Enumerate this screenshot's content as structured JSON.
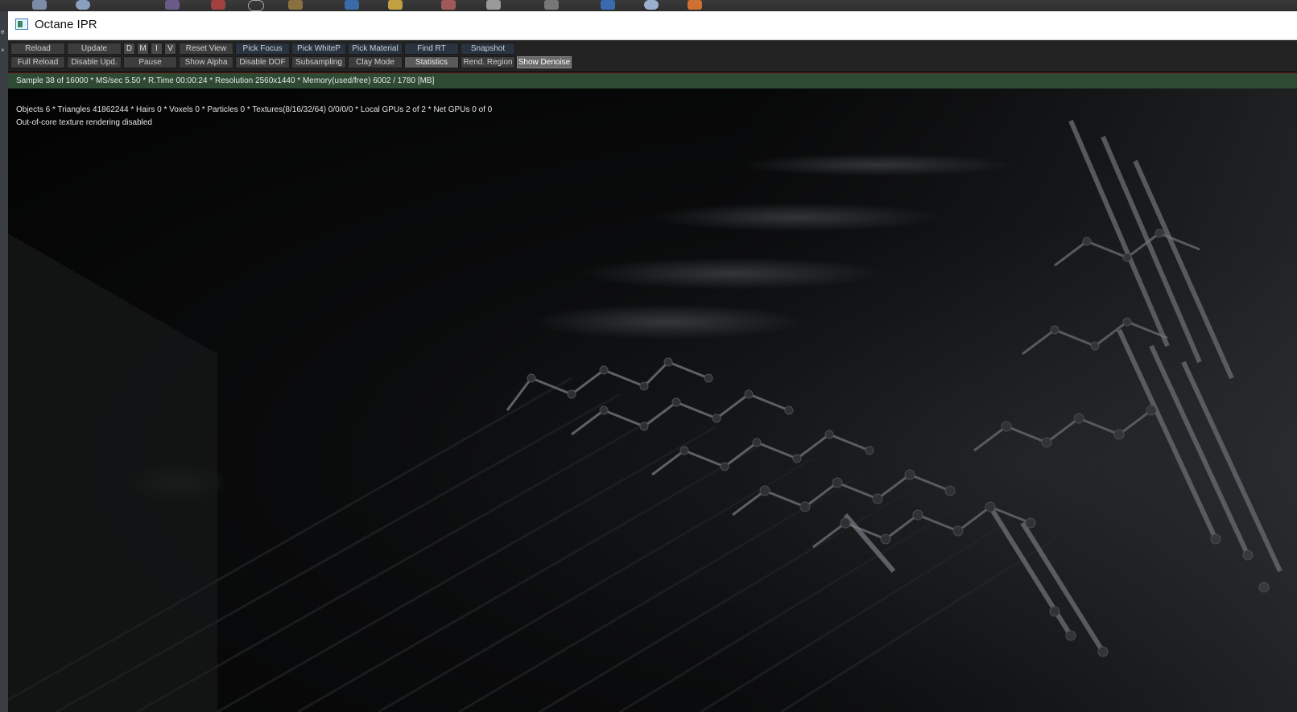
{
  "window": {
    "title": "Octane IPR",
    "icon": "octane-app-icon"
  },
  "toolbar": {
    "row1": [
      {
        "key": "reload",
        "label": "Reload"
      },
      {
        "key": "update",
        "label": "Update"
      },
      {
        "key": "d",
        "label": "D"
      },
      {
        "key": "m",
        "label": "M"
      },
      {
        "key": "i",
        "label": "I"
      },
      {
        "key": "v",
        "label": "V"
      },
      {
        "key": "reset_view",
        "label": "Reset View"
      },
      {
        "key": "pick_focus",
        "label": "Pick Focus"
      },
      {
        "key": "pick_whitep",
        "label": "Pick WhiteP"
      },
      {
        "key": "pick_material",
        "label": "Pick Material"
      },
      {
        "key": "find_rt",
        "label": "Find RT"
      },
      {
        "key": "snapshot",
        "label": "Snapshot"
      }
    ],
    "row2": [
      {
        "key": "full_reload",
        "label": "Full Reload"
      },
      {
        "key": "disable_upd",
        "label": "Disable Upd."
      },
      {
        "key": "pause",
        "label": "Pause"
      },
      {
        "key": "show_alpha",
        "label": "Show Alpha"
      },
      {
        "key": "disable_dof",
        "label": "Disable DOF"
      },
      {
        "key": "subsampling",
        "label": "Subsampling"
      },
      {
        "key": "clay_mode",
        "label": "Clay Mode"
      },
      {
        "key": "statistics",
        "label": "Statistics"
      },
      {
        "key": "rend_region",
        "label": "Rend. Region"
      },
      {
        "key": "show_denoise",
        "label": "Show Denoise"
      }
    ]
  },
  "status": {
    "text": "Sample 38 of 16000 * MS/sec 5.50 * R.Time 00:00:24 * Resolution 2560x1440 * Memory(used/free) 6002 / 1780 [MB]"
  },
  "info": {
    "line1": "Objects 6 * Triangles 41862244 * Hairs 0 * Voxels 0 * Particles 0 * Textures(8/16/32/64) 0/0/0/0 * Local GPUs 2 of 2 * Net GPUs 0 of 0",
    "line2": "Out-of-core texture rendering disabled"
  },
  "colors": {
    "status_bg": "#2f4a32",
    "toolbar_bg": "#232323",
    "viewport_bg": "#050505"
  }
}
